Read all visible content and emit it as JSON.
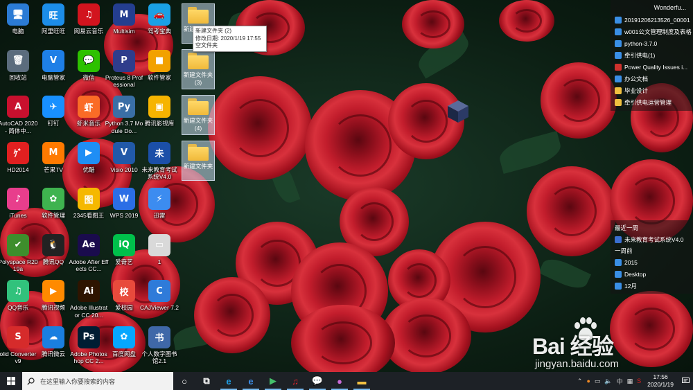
{
  "desktop": {
    "icons": [
      {
        "label": "电脑",
        "glyph": "🖥",
        "color": "#2b7bd4"
      },
      {
        "label": "阿里旺旺",
        "glyph": "旺",
        "color": "#1c8de8"
      },
      {
        "label": "网易云音乐",
        "glyph": "♫",
        "color": "#d2141e"
      },
      {
        "label": "Multisim",
        "glyph": "M",
        "color": "#243e8f"
      },
      {
        "label": "驾考宝典",
        "glyph": "🚗",
        "color": "#1aa1e6"
      },
      {
        "label": "回收站",
        "glyph": "🗑",
        "color": "#5b6c7d"
      },
      {
        "label": "电脑管家",
        "glyph": "V",
        "color": "#1e7fe6"
      },
      {
        "label": "微信",
        "glyph": "💬",
        "color": "#2dc100"
      },
      {
        "label": "Proteus 8 Professional",
        "glyph": "P",
        "color": "#2f3d8c"
      },
      {
        "label": "软件管家",
        "glyph": "■",
        "color": "#f2a100"
      },
      {
        "label": "AutoCAD 2020 - 简体中...",
        "glyph": "A",
        "color": "#c8102e"
      },
      {
        "label": "钉钉",
        "glyph": "✈",
        "color": "#1890ff"
      },
      {
        "label": "虾米音乐",
        "glyph": "虾",
        "color": "#fa6b26"
      },
      {
        "label": "Python 3.7 Module Do...",
        "glyph": "Py",
        "color": "#3a6fa6"
      },
      {
        "label": "腾讯影视库",
        "glyph": "▣",
        "color": "#f6b400"
      },
      {
        "label": "HD2014",
        "glyph": "ｹﾞ",
        "color": "#e02020"
      },
      {
        "label": "芒果TV",
        "glyph": "M",
        "color": "#ff7a00"
      },
      {
        "label": "优酷",
        "glyph": "▶",
        "color": "#1f8ef5"
      },
      {
        "label": "Visio 2010",
        "glyph": "V",
        "color": "#2159a8"
      },
      {
        "label": "未来教育考试系统V4.0",
        "glyph": "未",
        "color": "#1b4fa8"
      },
      {
        "label": "iTunes",
        "glyph": "♪",
        "color": "#e83e8c"
      },
      {
        "label": "软件管理",
        "glyph": "✿",
        "color": "#3fb34f"
      },
      {
        "label": "2345看图王",
        "glyph": "图",
        "color": "#f5b800"
      },
      {
        "label": "WPS 2019",
        "glyph": "W",
        "color": "#2b6ee6"
      },
      {
        "label": "迅雷",
        "glyph": "⚡",
        "color": "#3c8cf0"
      },
      {
        "label": "Polyspace R2019a",
        "glyph": "✔",
        "color": "#3e8e2c"
      },
      {
        "label": "腾讯QQ",
        "glyph": "🐧",
        "color": "#222222"
      },
      {
        "label": "Adobe After Effects CC...",
        "glyph": "Ae",
        "color": "#1a0b4d"
      },
      {
        "label": "爱奇艺",
        "glyph": "iQ",
        "color": "#00c04b"
      },
      {
        "label": "1",
        "glyph": "▭",
        "color": "#d9d9d9"
      },
      {
        "label": "QQ音乐",
        "glyph": "♫",
        "color": "#31c27c"
      },
      {
        "label": "腾讯视频",
        "glyph": "▶",
        "color": "#ff8a00"
      },
      {
        "label": "Adobe Illustrator CC 20...",
        "glyph": "Ai",
        "color": "#2e1400"
      },
      {
        "label": "爱校园",
        "glyph": "校",
        "color": "#e84a3c"
      },
      {
        "label": "CAJViewer 7.2",
        "glyph": "C",
        "color": "#2f7bd9"
      },
      {
        "label": "olid Converter v9",
        "glyph": "S",
        "color": "#d62b2b"
      },
      {
        "label": "腾讯微云",
        "glyph": "☁",
        "color": "#1a7fe0"
      },
      {
        "label": "Adobe Photoshop CC 2...",
        "glyph": "Ps",
        "color": "#001d33"
      },
      {
        "label": "百度网盘",
        "glyph": "✿",
        "color": "#06a7ff"
      },
      {
        "label": "个人数字图书馆2.1",
        "glyph": "书",
        "color": "#3f68a8"
      }
    ],
    "folders": [
      {
        "label": "新建文件夹 (2)"
      },
      {
        "label": "新建文件夹 (3)"
      },
      {
        "label": "新建文件夹 (4)"
      },
      {
        "label": "新建文件夹"
      }
    ],
    "tooltip": {
      "line1": "新建文件夹 (2)",
      "line2": "修改日期: 2020/1/19 17:55",
      "line3": "空文件夹"
    }
  },
  "fence_top": {
    "title": "Wonderfu...",
    "items": [
      {
        "label": "20191206213526_00001",
        "color": "#3a8ee6"
      },
      {
        "label": "w001公文管理制度及表格",
        "color": "#3a8ee6"
      },
      {
        "label": "python-3.7.0",
        "color": "#3a8ee6"
      },
      {
        "label": "牵引供电(1)",
        "color": "#3a8ee6"
      },
      {
        "label": "Power Quality Issues i...",
        "color": "#d0312d"
      },
      {
        "label": "办公文档",
        "color": "#3a8ee6"
      },
      {
        "label": "毕业设计",
        "color": "#f0c040"
      },
      {
        "label": "牵引供电运营管理",
        "color": "#f0c040"
      }
    ]
  },
  "fence_recent": {
    "week1": "最近一周",
    "week1_items": [
      {
        "label": "未来教育考试系统V4.0",
        "color": "#3a6fd0"
      }
    ],
    "week2": "一周前",
    "week2_items": [
      {
        "label": "2015",
        "color": "#3a8ee6"
      },
      {
        "label": "Desktop",
        "color": "#3a8ee6"
      },
      {
        "label": "12月",
        "color": "#3a8ee6"
      }
    ]
  },
  "watermark": {
    "logo": "Bai 经验",
    "url": "jingyan.baidu.com"
  },
  "taskbar": {
    "search_placeholder": "在这里输入你要搜索的内容",
    "apps": [
      {
        "name": "cortana-icon",
        "glyph": "○",
        "color": "#ffffff"
      },
      {
        "name": "task-view-icon",
        "glyph": "⧉",
        "color": "#ffffff"
      },
      {
        "name": "ie-icon",
        "glyph": "e",
        "color": "#1ea0e8"
      },
      {
        "name": "edge-icon",
        "glyph": "e",
        "color": "#3d8ee8"
      },
      {
        "name": "video-player-icon",
        "glyph": "▶",
        "color": "#45c06a"
      },
      {
        "name": "netease-music-icon",
        "glyph": "♫",
        "color": "#e0242b"
      },
      {
        "name": "wechat-icon",
        "glyph": "💬",
        "color": "#2dc100"
      },
      {
        "name": "app-icon",
        "glyph": "●",
        "color": "#c86ad6"
      },
      {
        "name": "file-explorer-icon",
        "glyph": "▬",
        "color": "#f4c242"
      }
    ],
    "tray": {
      "ime": "中",
      "time": "17:56",
      "date": "2020/1/19"
    }
  }
}
